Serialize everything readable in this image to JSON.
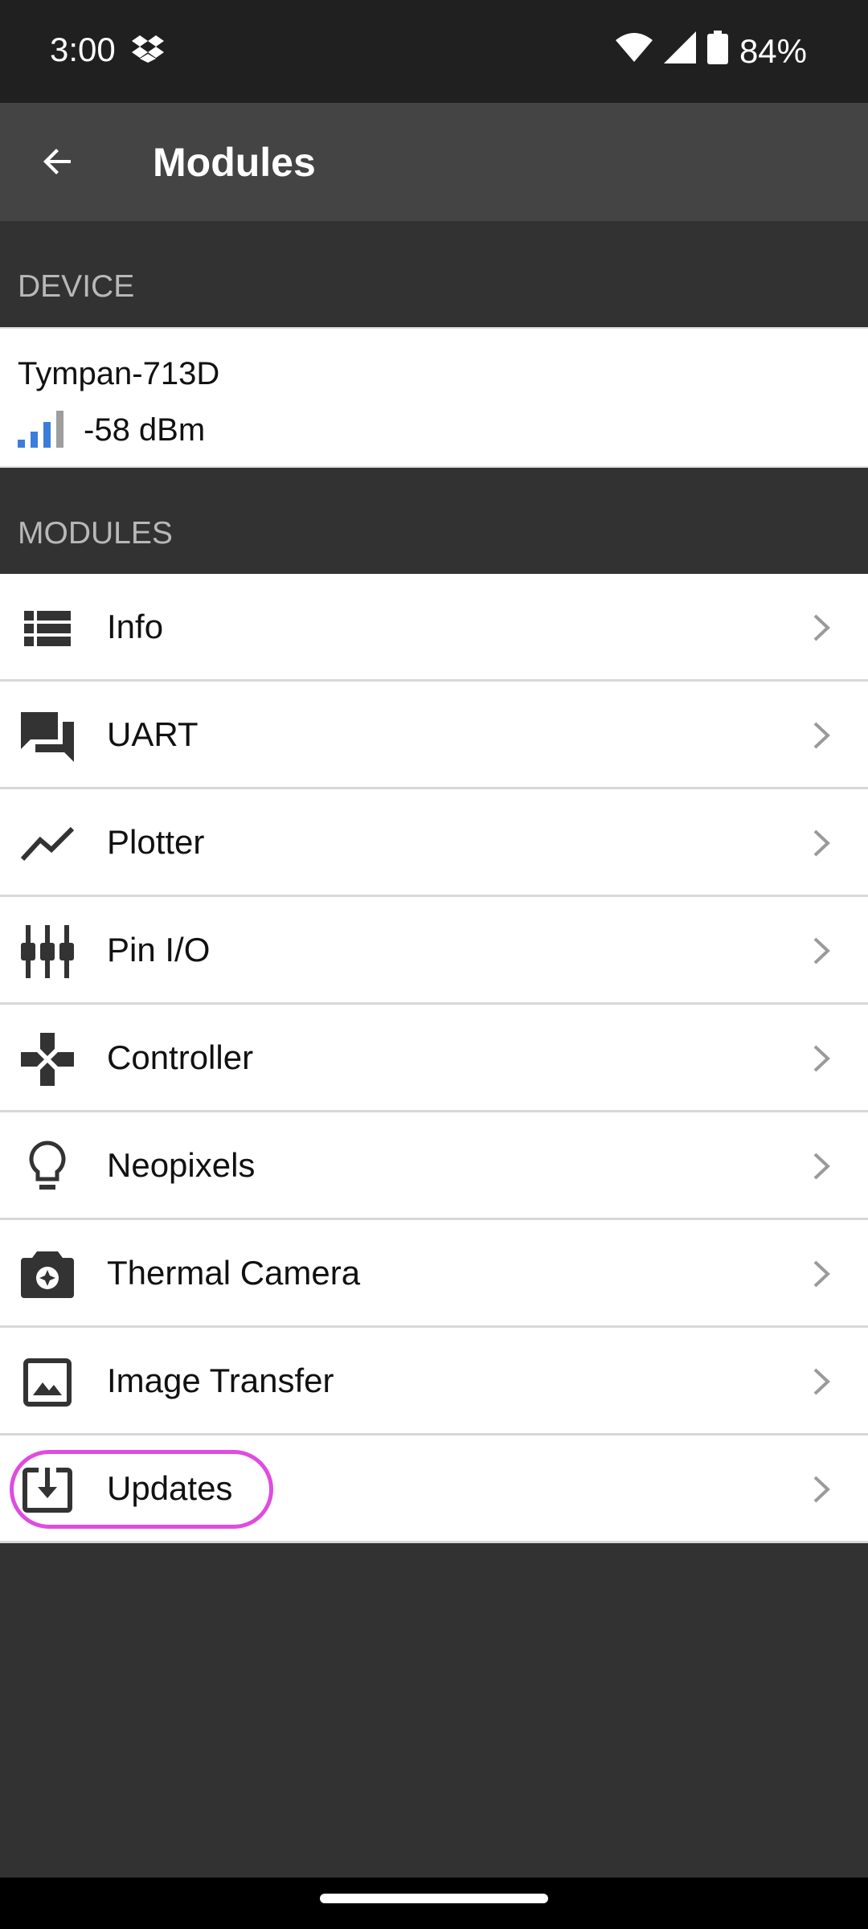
{
  "status_bar": {
    "time": "3:00",
    "battery": "84%",
    "icons": [
      "dropbox-icon",
      "wifi-icon",
      "cell-signal-icon",
      "battery-icon"
    ]
  },
  "app_bar": {
    "title": "Modules",
    "back_icon": "arrow-back-icon"
  },
  "device_section": {
    "header": "DEVICE",
    "device_name": "Tympan-713D",
    "rssi": "-58 dBm",
    "signal_icon": "signal-strength-icon"
  },
  "modules_section": {
    "header": "MODULES",
    "items": [
      {
        "label": "Info",
        "icon": "list-icon"
      },
      {
        "label": "UART",
        "icon": "chat-icon"
      },
      {
        "label": "Plotter",
        "icon": "line-chart-icon"
      },
      {
        "label": "Pin I/O",
        "icon": "pins-icon"
      },
      {
        "label": "Controller",
        "icon": "gamepad-icon"
      },
      {
        "label": "Neopixels",
        "icon": "lightbulb-icon"
      },
      {
        "label": "Thermal Camera",
        "icon": "camera-icon"
      },
      {
        "label": "Image Transfer",
        "icon": "image-icon"
      },
      {
        "label": "Updates",
        "icon": "download-icon",
        "highlighted": true
      }
    ]
  },
  "colors": {
    "status_bar_bg": "#202020",
    "app_bar_bg": "#444444",
    "page_bg": "#323232",
    "section_header_text": "#b8b8b8",
    "signal_blue": "#3b7ddd",
    "highlight": "#e04be0"
  }
}
